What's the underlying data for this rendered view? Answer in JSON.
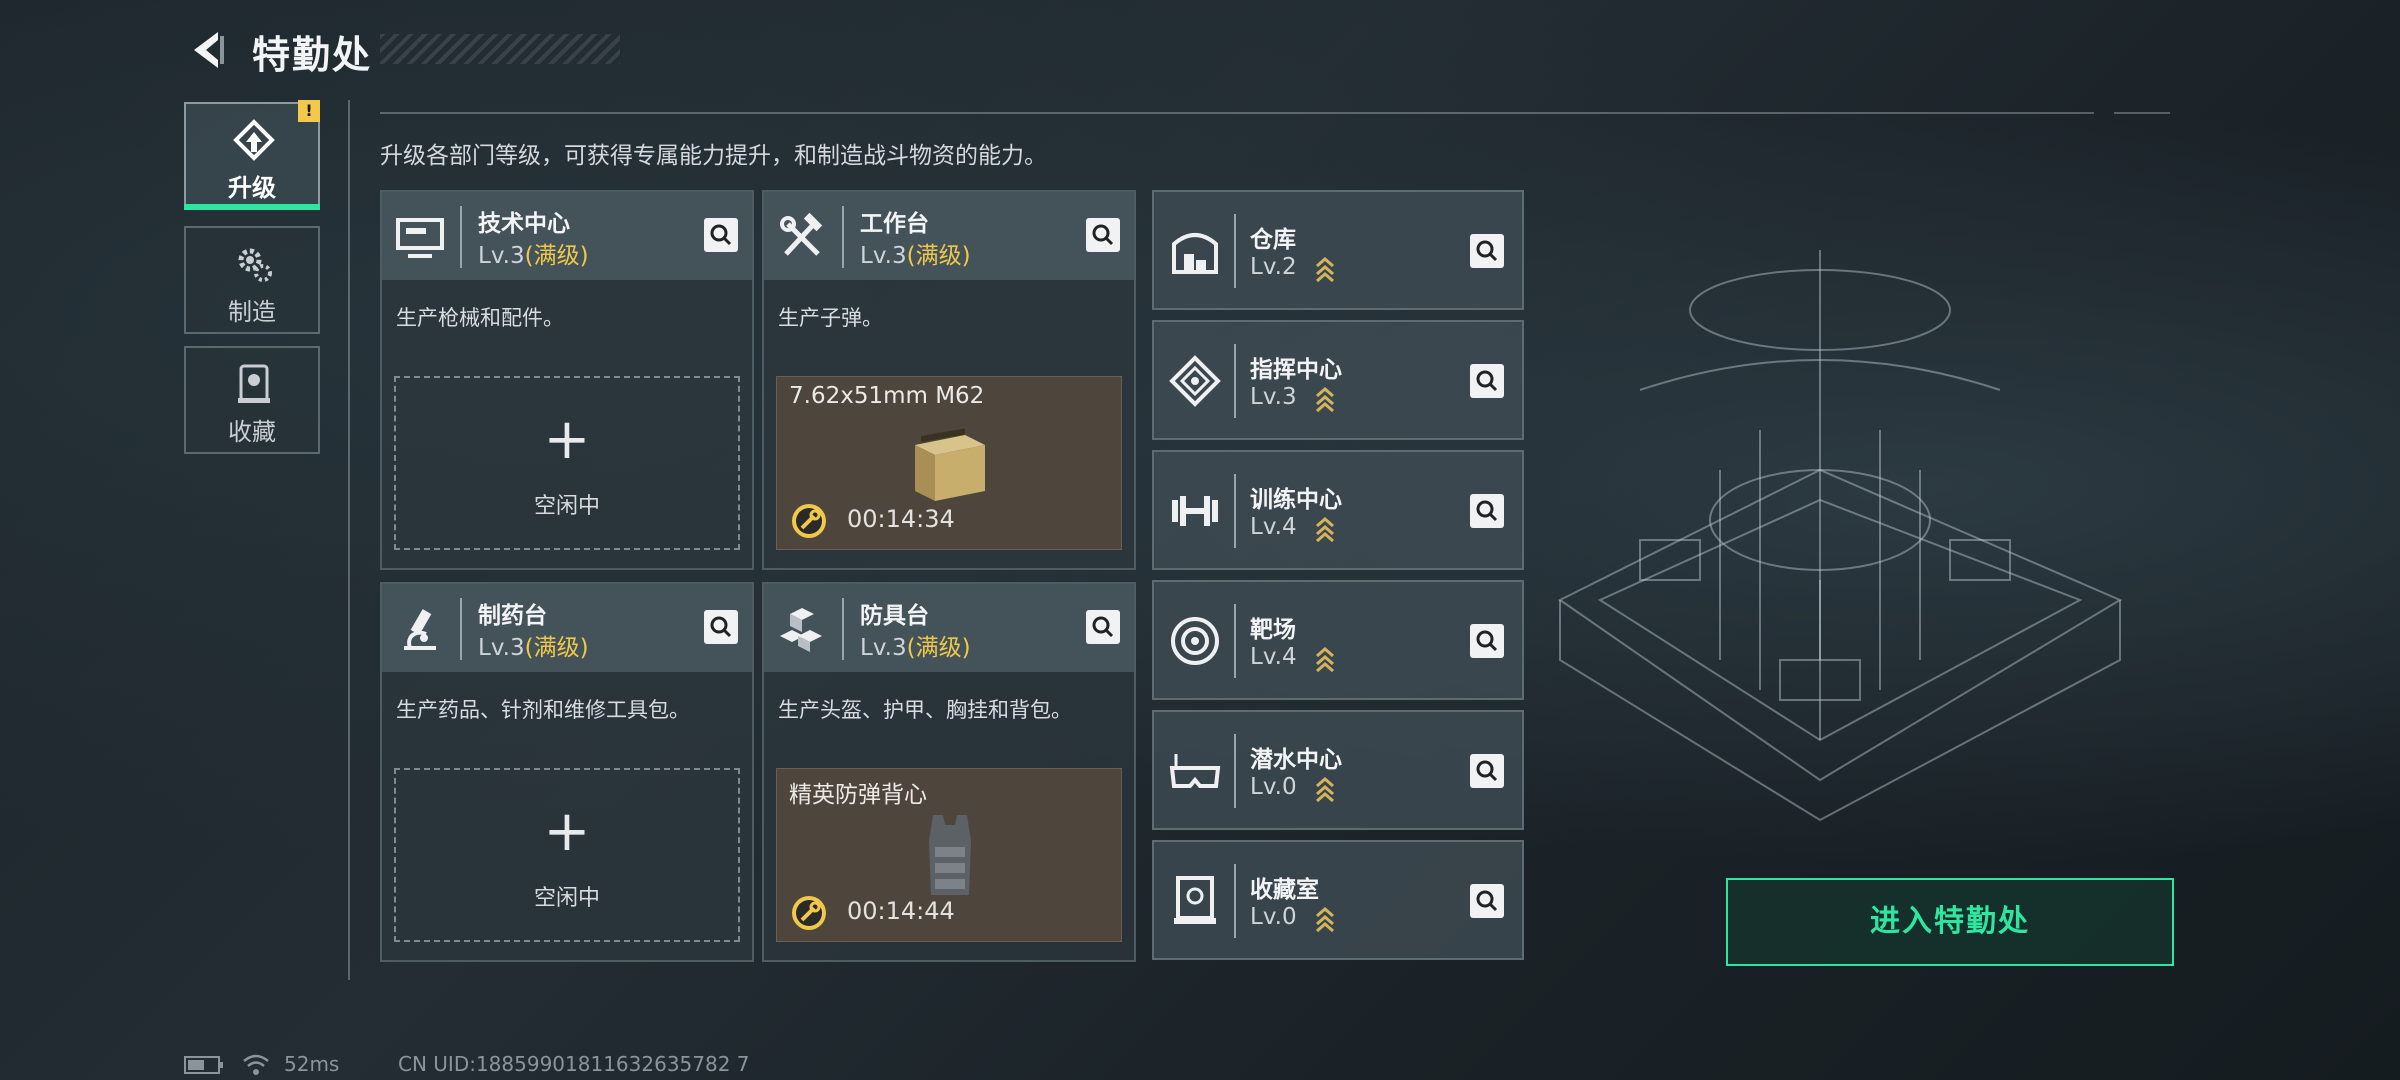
{
  "header": {
    "title": "特勤处"
  },
  "tabs": [
    {
      "label": "升级",
      "icon": "upgrade-icon",
      "alert": "!"
    },
    {
      "label": "制造",
      "icon": "gear-icon"
    },
    {
      "label": "收藏",
      "icon": "collection-icon"
    }
  ],
  "description": "升级各部门等级，可获得专属能力提升，和制造战斗物资的能力。",
  "facilities": [
    {
      "name": "技术中心",
      "level": "Lv.3",
      "max": "(满级)",
      "desc": "生产枪械和配件。",
      "slot": {
        "state": "idle",
        "plus": "+",
        "label": "空闲中"
      },
      "icon": "monitor-icon"
    },
    {
      "name": "工作台",
      "level": "Lv.3",
      "max": "(满级)",
      "desc": "生产子弹。",
      "slot": {
        "state": "producing",
        "item": "7.62x51mm M62",
        "timer": "00:14:34"
      },
      "icon": "tools-icon"
    },
    {
      "name": "制药台",
      "level": "Lv.3",
      "max": "(满级)",
      "desc": "生产药品、针剂和维修工具包。",
      "slot": {
        "state": "idle",
        "plus": "+",
        "label": "空闲中"
      },
      "icon": "microscope-icon"
    },
    {
      "name": "防具台",
      "level": "Lv.3",
      "max": "(满级)",
      "desc": "生产头盔、护甲、胸挂和背包。",
      "slot": {
        "state": "producing",
        "item": "精英防弹背心",
        "timer": "00:14:44"
      },
      "icon": "armor-icon"
    }
  ],
  "departments": [
    {
      "name": "仓库",
      "level": "Lv.2",
      "icon": "warehouse-icon"
    },
    {
      "name": "指挥中心",
      "level": "Lv.3",
      "icon": "command-icon"
    },
    {
      "name": "训练中心",
      "level": "Lv.4",
      "icon": "dumbbell-icon"
    },
    {
      "name": "靶场",
      "level": "Lv.4",
      "icon": "target-icon"
    },
    {
      "name": "潜水中心",
      "level": "Lv.0",
      "icon": "diving-mask-icon"
    },
    {
      "name": "收藏室",
      "level": "Lv.0",
      "icon": "collection-room-icon"
    }
  ],
  "enter_button": "进入特勤处",
  "status": {
    "ping": "52ms",
    "uid": "CN UID:18859901811632635782 7"
  },
  "colors": {
    "accent": "#2ee6a0",
    "max_level": "#f0c94a",
    "alert": "#f4c84a"
  }
}
